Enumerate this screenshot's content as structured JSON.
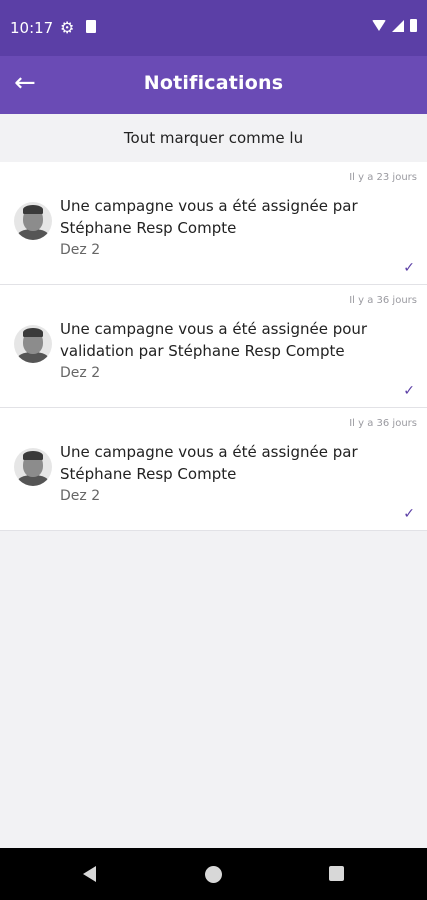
{
  "status_bar": {
    "time": "10:17"
  },
  "app_bar": {
    "title": "Notifications",
    "back_icon": "arrow-left-icon"
  },
  "actions": {
    "mark_all_read": "Tout marquer comme lu"
  },
  "notifications": [
    {
      "time": "Il y a 23 jours",
      "message": "Une campagne vous a été assignée par Stéphane Resp Compte",
      "subtitle": "Dez 2",
      "read": true
    },
    {
      "time": "Il y a 36 jours",
      "message": "Une campagne vous a été assignée pour validation par Stéphane Resp Compte",
      "subtitle": "Dez 2",
      "read": true
    },
    {
      "time": "Il y a 36 jours",
      "message": "Une campagne vous a été assignée par Stéphane Resp Compte",
      "subtitle": "Dez 2",
      "read": true
    }
  ],
  "colors": {
    "header": "#5b3fa6",
    "appbar": "#6a4bb5",
    "check": "#5b3fa6"
  }
}
